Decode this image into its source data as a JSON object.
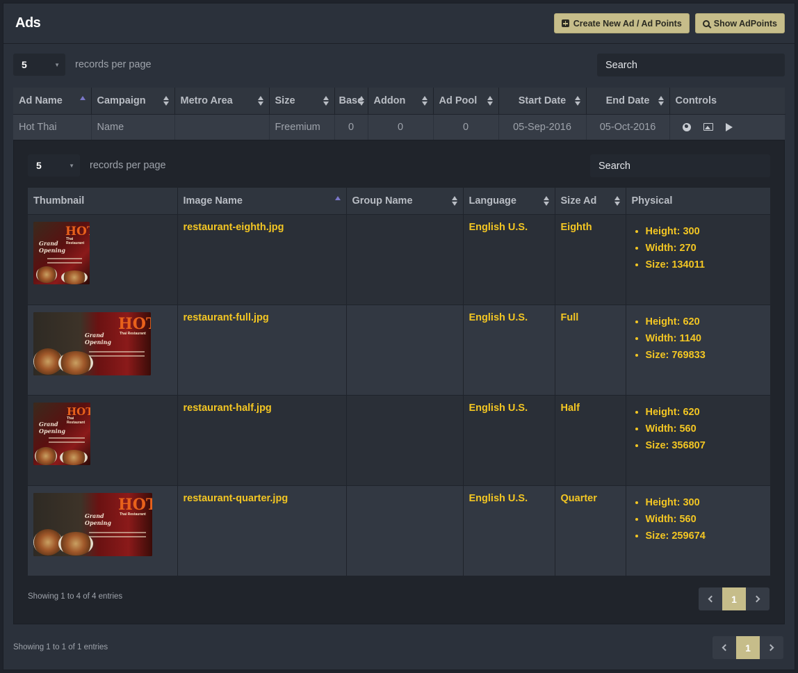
{
  "header": {
    "title": "Ads",
    "create_label": "Create New Ad / Ad Points",
    "show_label": "Show AdPoints"
  },
  "outer": {
    "page_size": "5",
    "records_per_page": "records per page",
    "search_placeholder": "Search",
    "columns": [
      "Ad Name",
      "Campaign",
      "Metro Area",
      "Size",
      "Base",
      "Addon",
      "Ad Pool",
      "Start Date",
      "End Date",
      "Controls"
    ],
    "row": {
      "ad_name": "Hot Thai",
      "campaign": "Name",
      "metro_area": "",
      "size": "Freemium",
      "base": "0",
      "addon": "0",
      "ad_pool": "0",
      "start_date": "05-Sep-2016",
      "end_date": "05-Oct-2016"
    },
    "info": "Showing 1 to 1 of 1 entries",
    "page": "1"
  },
  "inner": {
    "page_size": "5",
    "records_per_page": "records per page",
    "search_placeholder": "Search",
    "columns": [
      "Thumbnail",
      "Image Name",
      "Group Name",
      "Language",
      "Size Ad",
      "Physical"
    ],
    "rows": [
      {
        "image_name": "restaurant-eighth.jpg",
        "group_name": "",
        "language": "English U.S.",
        "size_ad": "Eighth",
        "height": "Height: 300",
        "width": "Width: 270",
        "size": "Size: 134011"
      },
      {
        "image_name": "restaurant-full.jpg",
        "group_name": "",
        "language": "English U.S.",
        "size_ad": "Full",
        "height": "Height: 620",
        "width": "Width: 1140",
        "size": "Size: 769833"
      },
      {
        "image_name": "restaurant-half.jpg",
        "group_name": "",
        "language": "English U.S.",
        "size_ad": "Half",
        "height": "Height: 620",
        "width": "Width: 560",
        "size": "Size: 356807"
      },
      {
        "image_name": "restaurant-quarter.jpg",
        "group_name": "",
        "language": "English U.S.",
        "size_ad": "Quarter",
        "height": "Height: 300",
        "width": "Width: 560",
        "size": "Size: 259674"
      }
    ],
    "thumb_hot": "HOT",
    "thumb_sub": "Thai Restaurant",
    "thumb_script": "Grand Opening",
    "info": "Showing 1 to 4 of 4 entries",
    "page": "1"
  }
}
